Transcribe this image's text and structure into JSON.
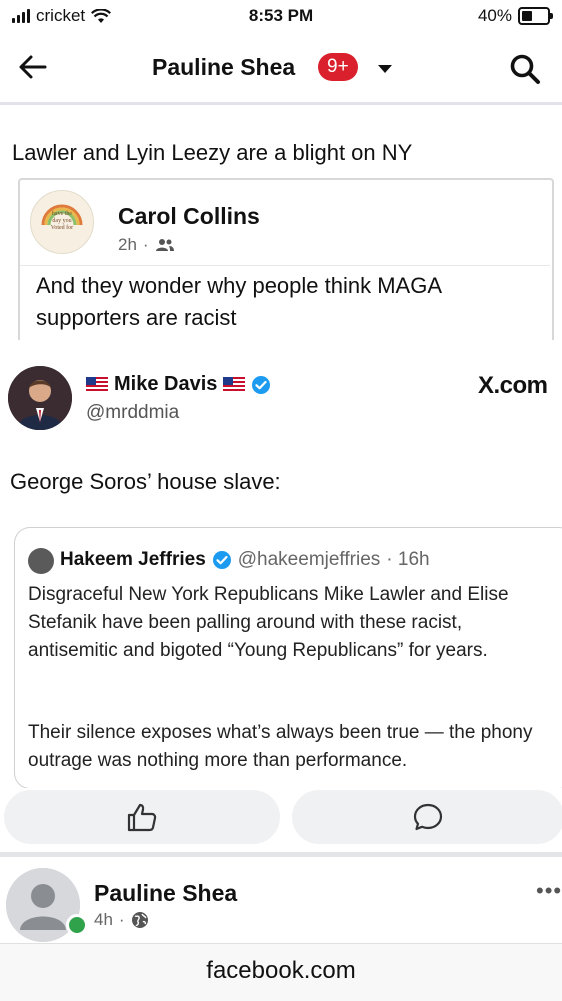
{
  "status_bar": {
    "carrier": "cricket",
    "time": "8:53 PM",
    "battery": "40%",
    "battery_level": 0.4
  },
  "header": {
    "title": "Pauline Shea",
    "badge": "9+"
  },
  "post": {
    "text": "Lawler and Lyin Leezy are a blight on NY",
    "shared": {
      "author": "Carol Collins",
      "time": "2h",
      "avatar_text": "have the day you Voted for",
      "text": "And they wonder why people think MAGA supporters are racist"
    }
  },
  "tweet": {
    "author": "Mike Davis",
    "handle": "@mrddmia",
    "source": "X.com",
    "text": "George Soros’ house slave:",
    "quote": {
      "author": "Hakeem Jeffries",
      "handle": "@hakeemjeffries",
      "time": "· 16h",
      "paragraph1": "Disgraceful New York Republicans Mike Lawler and Elise Stefanik have been palling around with these racist, antisemitic and bigoted “Young Republicans” for years.",
      "paragraph2": "Their silence exposes what’s always been true — the phony outrage was nothing more than performance."
    }
  },
  "next_post": {
    "author": "Pauline Shea",
    "time": "4h"
  },
  "url_bar": {
    "url": "facebook.com"
  },
  "colors": {
    "badge": "#d9202c",
    "verified": "#1d9bf0",
    "online": "#31a24c",
    "action_bg": "#f0f1f3"
  }
}
